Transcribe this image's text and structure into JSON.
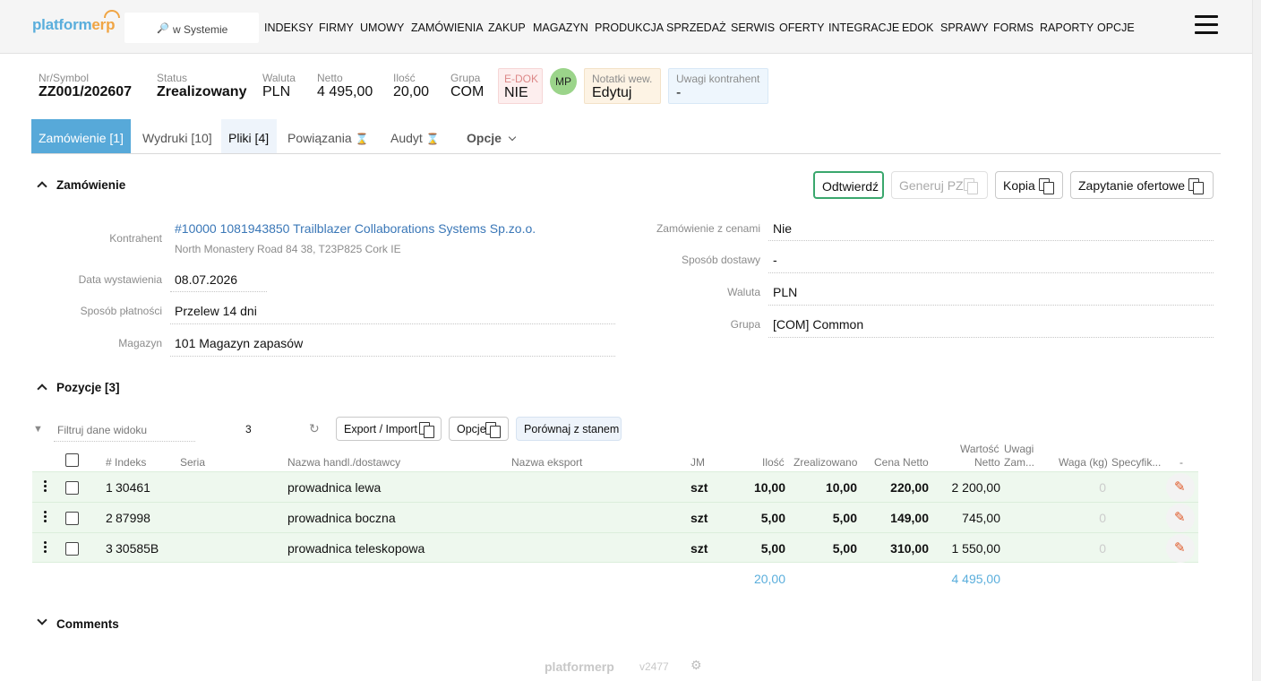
{
  "app": {
    "logo_part1": "platform",
    "logo_part2": "erp"
  },
  "search": {
    "placeholder": "w Systemie"
  },
  "nav": [
    "INDEKSY",
    "FIRMY",
    "UMOWY",
    "ZAMÓWIENIA",
    "ZAKUP",
    "MAGAZYN",
    "PRODUKCJA",
    "SPRZEDAŻ",
    "SERWIS",
    "OFERTY",
    "INTEGRACJE",
    "EDOK",
    "SPRAWY",
    "FORMS",
    "RAPORTY",
    "OPCJE"
  ],
  "header": {
    "symbol_label": "Nr/Symbol",
    "symbol": "ZZ001/202607",
    "status_label": "Status",
    "status": "Zrealizowany",
    "currency_label": "Waluta",
    "currency": "PLN",
    "net_label": "Netto",
    "net": "4 495,00",
    "qty_label": "Ilość",
    "qty": "20,00",
    "group_label": "Grupa",
    "group": "COM",
    "edok_label": "E-DOK",
    "edok": "NIE",
    "avatar": "MP",
    "notes_label": "Notatki wew.",
    "notes": "Edytuj",
    "remarks_label": "Uwagi kontrahent",
    "remarks": "-"
  },
  "tabs": {
    "order": "Zamówienie [1]",
    "prints": "Wydruki [10]",
    "files": "Pliki [4]",
    "relations": "Powiązania",
    "audit": "Audyt",
    "options": "Opcje"
  },
  "order_section": {
    "title": "Zamówienie",
    "buttons": {
      "confirm": "Odtwierdź",
      "generate_pz": "Generuj PZ",
      "copy": "Kopia",
      "inquiry": "Zapytanie ofertowe"
    },
    "contractor_label": "Kontrahent",
    "contractor": "#10000 1081943850 Trailblazer Collaborations Systems Sp.zo.o.",
    "contractor_address": "North Monastery Road 84 38, T23P825 Cork IE",
    "issue_date_label": "Data wystawienia",
    "issue_date": "08.07.2026",
    "payment_label": "Sposób płatności",
    "payment": "Przelew 14 dni",
    "warehouse_label": "Magazyn",
    "warehouse": "101 Magazyn zapasów",
    "with_prices_label": "Zamówienie z cenami",
    "with_prices": "Nie",
    "delivery_label": "Sposób dostawy",
    "delivery": "-",
    "currency_label": "Waluta",
    "currency": "PLN",
    "group_label": "Grupa",
    "group": "[COM] Common"
  },
  "positions": {
    "title": "Pozycje [3]",
    "filter_placeholder": "Filtruj dane widoku",
    "count": "3",
    "export_btn": "Export / Import",
    "options_btn": "Opcje",
    "compare_btn": "Porównaj z stanem",
    "columns": {
      "index": "# Indeks",
      "series": "Seria",
      "trade_name": "Nazwa handl./dostawcy",
      "export_name": "Nazwa eksport",
      "unit": "JM",
      "qty": "Ilość",
      "realized": "Zrealizowano",
      "net_price": "Cena Netto",
      "net_value_1": "Wartość",
      "net_value_2": "Netto",
      "remarks_1": "Uwagi",
      "remarks_2": "Zam...",
      "weight": "Waga (kg)",
      "spec": "Specyfik...",
      "dash": "-"
    },
    "rows": [
      {
        "no": "1",
        "index": "30461",
        "name": "prowadnica lewa",
        "unit": "szt",
        "qty": "10,00",
        "realized": "10,00",
        "price": "220,00",
        "value": "2 200,00",
        "weight": "0"
      },
      {
        "no": "2",
        "index": "87998",
        "name": "prowadnica boczna",
        "unit": "szt",
        "qty": "5,00",
        "realized": "5,00",
        "price": "149,00",
        "value": "745,00",
        "weight": "0"
      },
      {
        "no": "3",
        "index": "30585B",
        "name": "prowadnica teleskopowa",
        "unit": "szt",
        "qty": "5,00",
        "realized": "5,00",
        "price": "310,00",
        "value": "1 550,00",
        "weight": "0"
      }
    ],
    "total_qty": "20,00",
    "total_value": "4 495,00"
  },
  "comments": {
    "title": "Comments"
  },
  "footer": {
    "logo_part1": "platform",
    "logo_part2": "erp",
    "version": "v2477"
  },
  "colors": {
    "accent": "#5aaedc",
    "active_tab": "#57a9d9",
    "row_bg": "#eef8ee",
    "confirm_border": "#3aa76d"
  }
}
